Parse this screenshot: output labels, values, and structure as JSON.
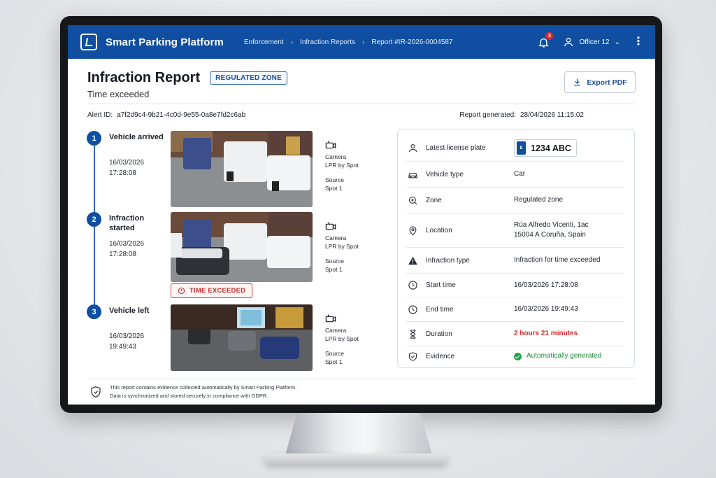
{
  "app": {
    "brand": "Smart Parking Platform",
    "breadcrumb": [
      "Enforcement",
      "Infraction Reports",
      "Report #IR-2026-0004587"
    ],
    "notifications_count": "3",
    "user": "Officer 12"
  },
  "colors": {
    "topbar": "#0f4ea0",
    "accent": "#1d4f9e",
    "danger": "#d42a2a",
    "success": "#22a046"
  },
  "report": {
    "title": "Infraction Report",
    "zone_badge": "REGULATED ZONE",
    "subtitle": "Time exceeded",
    "export_label": "Export PDF",
    "alert_label": "Alert ID:",
    "alert_id": "a7f2d9c4-9b21-4c0d-9e55-0a8e7fd2c6ab",
    "generated_label": "Report generated:",
    "generated_at": "28/04/2026 11:15:02"
  },
  "timeline": [
    {
      "num": "1",
      "title": "Vehicle arrived",
      "date": "16/03/2026",
      "time": "17:28:08",
      "camera_label": "Camera",
      "camera": "LPR by Spot",
      "source_label": "Source",
      "source": "Spot 1",
      "icon": "camera-icon"
    },
    {
      "num": "2",
      "title": "Infraction started",
      "date": "16/03/2026",
      "time": "17:28:08",
      "camera_label": "Camera",
      "camera": "LPR by Spot",
      "source_label": "Source",
      "source": "Spot 1",
      "icon": "camera-icon"
    },
    {
      "num": "3",
      "title": "Vehicle left",
      "date": "16/03/2026",
      "time": "19:49:43",
      "camera_label": "Camera",
      "camera": "LPR by Spot",
      "source_label": "Source",
      "source": "Spot 1",
      "icon": "camera-icon"
    }
  ],
  "time_exceeded_badge": "TIME EXCEEDED",
  "details": [
    {
      "icon": "user-icon",
      "label": "Latest license plate",
      "value": "1234 ABC",
      "plate_country": "E"
    },
    {
      "icon": "car-icon",
      "label": "Vehicle type",
      "value": "Car"
    },
    {
      "icon": "zone-search-icon",
      "label": "Zone",
      "value": "Regulated zone"
    },
    {
      "icon": "location-pin-icon",
      "label": "Location",
      "value": "Rúa Alfredo Vicenti, 1ac",
      "value2": "15004 A Coruña, Spain"
    },
    {
      "icon": "warning-icon",
      "label": "Infraction type",
      "value": "Infraction for time exceeded"
    },
    {
      "icon": "clock-icon",
      "label": "Start time",
      "value": "16/03/2026 17:28:08"
    },
    {
      "icon": "clock-icon",
      "label": "End time",
      "value": "16/03/2026 19:49:43"
    },
    {
      "icon": "hourglass-icon",
      "label": "Duration",
      "value": "2 hours 21 minutes"
    },
    {
      "icon": "shield-check-icon",
      "label": "Evidence",
      "value": "Automatically generated"
    }
  ],
  "footer": {
    "line1": "This report contains evidence collected automatically by Smart Parking Platform.",
    "line2": "Data is synchronized and stored securely in compliance with GDPR."
  }
}
